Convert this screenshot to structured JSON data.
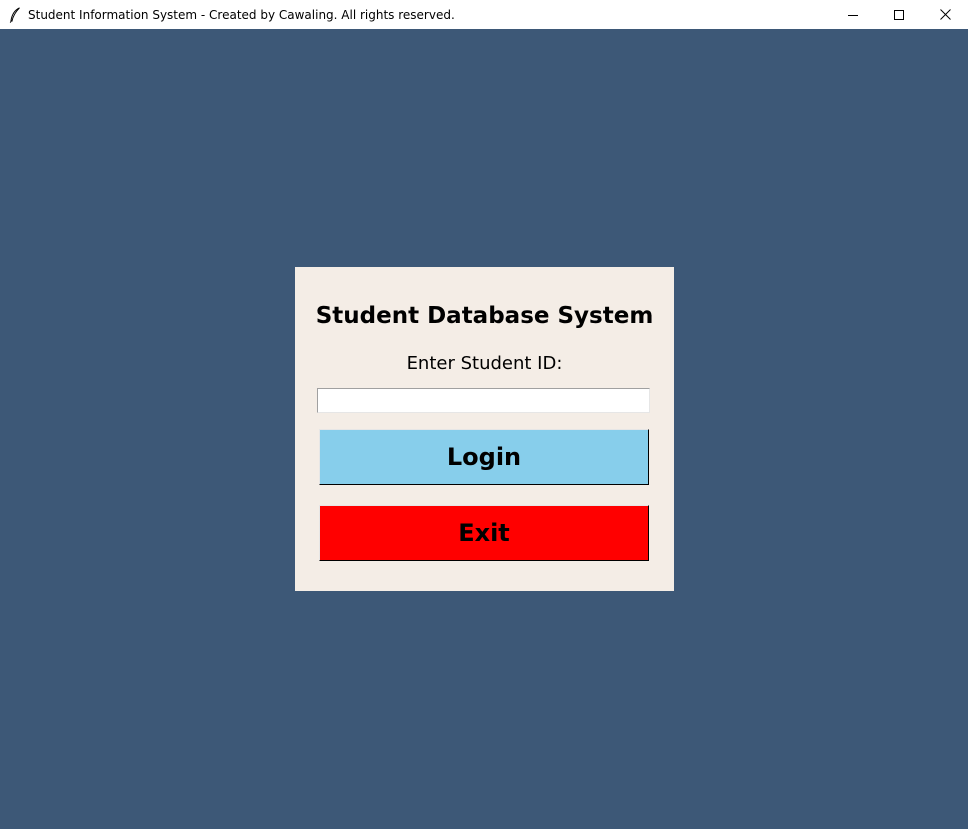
{
  "window": {
    "title": "Student Information System - Created by Cawaling. All rights reserved.",
    "app_icon": "feather-icon",
    "controls": {
      "minimize_icon": "minimize-icon",
      "maximize_icon": "maximize-icon",
      "close_icon": "close-icon"
    }
  },
  "colors": {
    "background": "#3d5877",
    "panel": "#f4ede6",
    "login_button": "#87ceeb",
    "exit_button": "#ff0000"
  },
  "login": {
    "title": "Student Database System",
    "id_label": "Enter Student ID:",
    "id_value": "",
    "login_label": "Login",
    "exit_label": "Exit"
  }
}
